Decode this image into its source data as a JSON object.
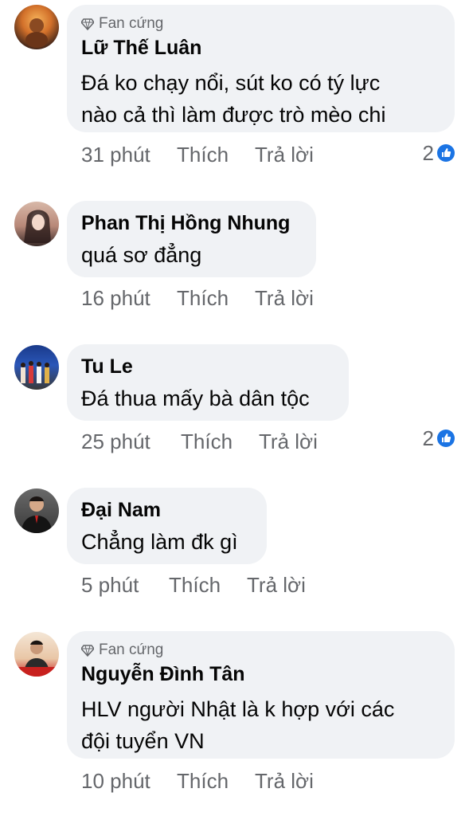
{
  "comments": [
    {
      "badge": "Fan cứng",
      "name": "Lữ Thế Luân",
      "lines": [
        "Đá ko chạy nổi, sút ko có tý lực",
        "nào cả thì làm được trò mèo chi"
      ],
      "time": "31 phút",
      "like": "Thích",
      "reply": "Trả lời",
      "reactions": "2"
    },
    {
      "name": "Phan Thị Hồng Nhung",
      "lines": [
        "quá sơ đẳng"
      ],
      "time": "16 phút",
      "like": "Thích",
      "reply": "Trả lời"
    },
    {
      "name": "Tu Le",
      "lines": [
        "Đá thua mấy bà dân tộc"
      ],
      "time": "25 phút",
      "like": "Thích",
      "reply": "Trả lời",
      "reactions": "2"
    },
    {
      "name": "Đại Nam",
      "lines": [
        "Chẳng làm đk gì"
      ],
      "time": "5 phút",
      "like": "Thích",
      "reply": "Trả lời"
    },
    {
      "badge": "Fan cứng",
      "name": "Nguyễn Đình Tân",
      "lines": [
        "HLV người Nhật là k hợp với các",
        "đội tuyển VN"
      ],
      "time": "10 phút",
      "like": "Thích",
      "reply": "Trả lời"
    }
  ],
  "colors": {
    "bubble": "#f0f2f5",
    "secondary_text": "#65676b",
    "like_blue": "#1b74e4"
  },
  "icons": {
    "badge": "diamond-icon",
    "reaction": "thumbs-up-icon"
  }
}
